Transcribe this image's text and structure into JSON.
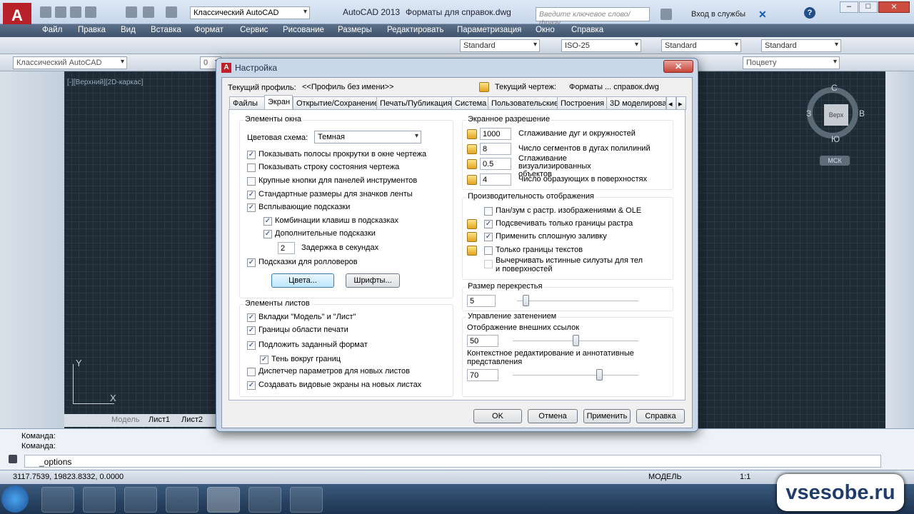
{
  "app": {
    "title": "AutoCAD 2013",
    "file": "Форматы для справок.dwg",
    "workspace": "Классический AutoCAD",
    "search_placeholder": "Введите ключевое слово/фразу",
    "login": "Вход в службы"
  },
  "menu": [
    "Файл",
    "Правка",
    "Вид",
    "Вставка",
    "Формат",
    "Сервис",
    "Рисование",
    "Размеры",
    "Редактировать",
    "Параметризация",
    "Окно",
    "Справка"
  ],
  "toolbar2": {
    "text_style": "Standard",
    "dim_style": "ISO-25",
    "table_style": "Standard",
    "mleader_style": "Standard"
  },
  "toolbar3": {
    "workspace": "Классический AutoCAD",
    "layer": "0",
    "linetype": "Поцвету"
  },
  "viewport": {
    "label": "[-][Верхний][2D-каркас]",
    "compass": {
      "n": "С",
      "s": "Ю",
      "w": "З",
      "e": "В",
      "cube": "Верх"
    },
    "ucs": "МСК",
    "axis_y": "Y",
    "axis_x": "X"
  },
  "layout_tabs": [
    "Модель",
    "Лист1",
    "Лист2"
  ],
  "command": {
    "line1": "Команда:",
    "line2": "Команда:",
    "input": "_options"
  },
  "status": {
    "coords": "3117.7539, 19823.8332, 0.0000",
    "model": "МОДЕЛЬ",
    "scale": "1:1"
  },
  "watermark": "vsesobe.ru",
  "dialog": {
    "title": "Настройка",
    "profile_label": "Текущий профиль:",
    "profile_value": "<<Профиль без имени>>",
    "drawing_label": "Текущий чертеж:",
    "drawing_value": "Форматы ... справок.dwg",
    "tabs": [
      "Файлы",
      "Экран",
      "Открытие/Сохранение",
      "Печать/Публикация",
      "Система",
      "Пользовательские",
      "Построения",
      "3D моделирова"
    ],
    "window_elements": {
      "title": "Элементы окна",
      "scheme_label": "Цветовая схема:",
      "scheme_value": "Темная",
      "checks": [
        "Показывать полосы прокрутки в окне чертежа",
        "Показывать строку состояния чертежа",
        "Крупные кнопки для панелей инструментов",
        "Стандартные размеры для значков ленты",
        "Всплывающие подсказки",
        "Комбинации клавиш в подсказках",
        "Дополнительные подсказки"
      ],
      "delay_value": "2",
      "delay_label": "Задержка в секундах",
      "rollover": "Подсказки для ролловеров",
      "colors_btn": "Цвета...",
      "fonts_btn": "Шрифты..."
    },
    "layout_elements": {
      "title": "Элементы листов",
      "checks": [
        "Вкладки \"Модель\" и \"Лист\"",
        "Границы области печати",
        "Подложить заданный формат",
        "Тень вокруг границ",
        "Диспетчер параметров для новых листов",
        "Создавать видовые экраны на новых листах"
      ]
    },
    "resolution": {
      "title": "Экранное разрешение",
      "rows": [
        {
          "value": "1000",
          "label": "Сглаживание дуг и окружностей"
        },
        {
          "value": "8",
          "label": "Число сегментов в дугах полилиний"
        },
        {
          "value": "0.5",
          "label": "Сглаживание визуализированных объектов"
        },
        {
          "value": "4",
          "label": "Число образующих в поверхностях"
        }
      ]
    },
    "performance": {
      "title": "Производительность отображения",
      "checks": [
        "Пан/зум с растр. изображениями & OLE",
        "Подсвечивать только границы растра",
        "Применить сплошную заливку",
        "Только границы текстов",
        "Вычерчивать истинные силуэты для тел и поверхностей"
      ]
    },
    "crosshair": {
      "title": "Размер перекрестья",
      "value": "5",
      "level": 5
    },
    "fading": {
      "title": "Управление затенением",
      "xref_label": "Отображение внешних ссылок",
      "xref_value": "50",
      "xref_level": 50,
      "inplace_label": "Контекстное редактирование и аннотативные представления",
      "inplace_value": "70",
      "inplace_level": 70
    },
    "buttons": {
      "ok": "OK",
      "cancel": "Отмена",
      "apply": "Применить",
      "help": "Справка"
    }
  }
}
